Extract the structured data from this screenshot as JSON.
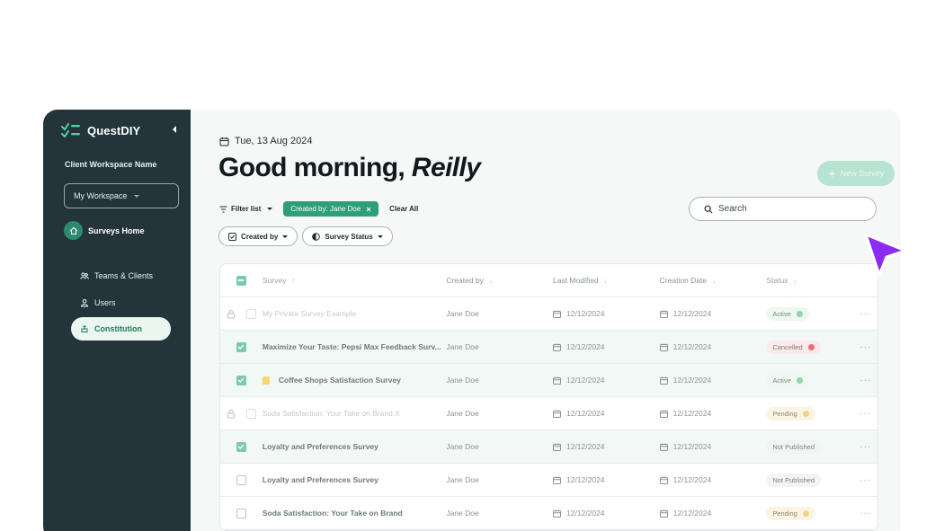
{
  "sidebar": {
    "brand": "QuestDIY",
    "workspace_title": "Client Workspace Name",
    "workspace_select": "My Workspace",
    "home": "Surveys Home",
    "items": [
      {
        "label": "Teams & Clients",
        "icon": "people-icon"
      },
      {
        "label": "Users",
        "icon": "user-icon"
      },
      {
        "label": "Constitution",
        "icon": "constitution-icon",
        "active": true
      }
    ]
  },
  "header": {
    "date": "Tue, 13 Aug 2024",
    "greeting": "Good morning,",
    "name": "Reilly",
    "new_survey": "New Survey"
  },
  "filters": {
    "filter_list": "Filter list",
    "active_chip": "Created by: Jane Doe",
    "clear_all": "Clear All",
    "created_by": "Created by",
    "survey_status": "Survey Status"
  },
  "search": {
    "placeholder": "Search"
  },
  "table": {
    "columns": [
      "Survey",
      "Created by",
      "Last Modified",
      "Creation Date",
      "Status"
    ],
    "rows": [
      {
        "check": "locked",
        "title": "My Private Survey Example",
        "muted": true,
        "created_by": "Jane Doe",
        "last_modified": "12/12/2024",
        "creation_date": "12/12/2024",
        "status": "Active"
      },
      {
        "check": "checked",
        "title": "Maximize Your Taste: Pepsi Max Feedback Surv...",
        "created_by": "Jane Doe",
        "last_modified": "12/12/2024",
        "creation_date": "12/12/2024",
        "status": "Cancelled"
      },
      {
        "check": "checked",
        "flag": true,
        "title": "Coffee Shops Satisfaction Survey",
        "created_by": "Jane Doe",
        "last_modified": "12/12/2024",
        "creation_date": "12/12/2024",
        "status": "Active"
      },
      {
        "check": "locked",
        "title": "Soda Satisfaction: Your Take on Brand X",
        "muted": true,
        "created_by": "Jane Doe",
        "last_modified": "12/12/2024",
        "creation_date": "12/12/2024",
        "status": "Pending"
      },
      {
        "check": "checked",
        "title": "Loyalty and Preferences Survey",
        "created_by": "Jane Doe",
        "last_modified": "12/12/2024",
        "creation_date": "12/12/2024",
        "status": "Not Published"
      },
      {
        "check": "empty",
        "title": "Loyalty and Preferences Survey",
        "created_by": "Jane Doe",
        "last_modified": "12/12/2024",
        "creation_date": "12/12/2024",
        "status": "Not Published"
      },
      {
        "check": "empty",
        "title": "Soda Satisfaction: Your Take on Brand",
        "created_by": "Jane Doe",
        "last_modified": "12/12/2024",
        "creation_date": "12/12/2024",
        "status": "Pending"
      }
    ],
    "more": "···"
  },
  "colors": {
    "sidebar_bg": "#23353a",
    "accent": "#2e9e7b",
    "cursor": "#8b2cf5"
  }
}
